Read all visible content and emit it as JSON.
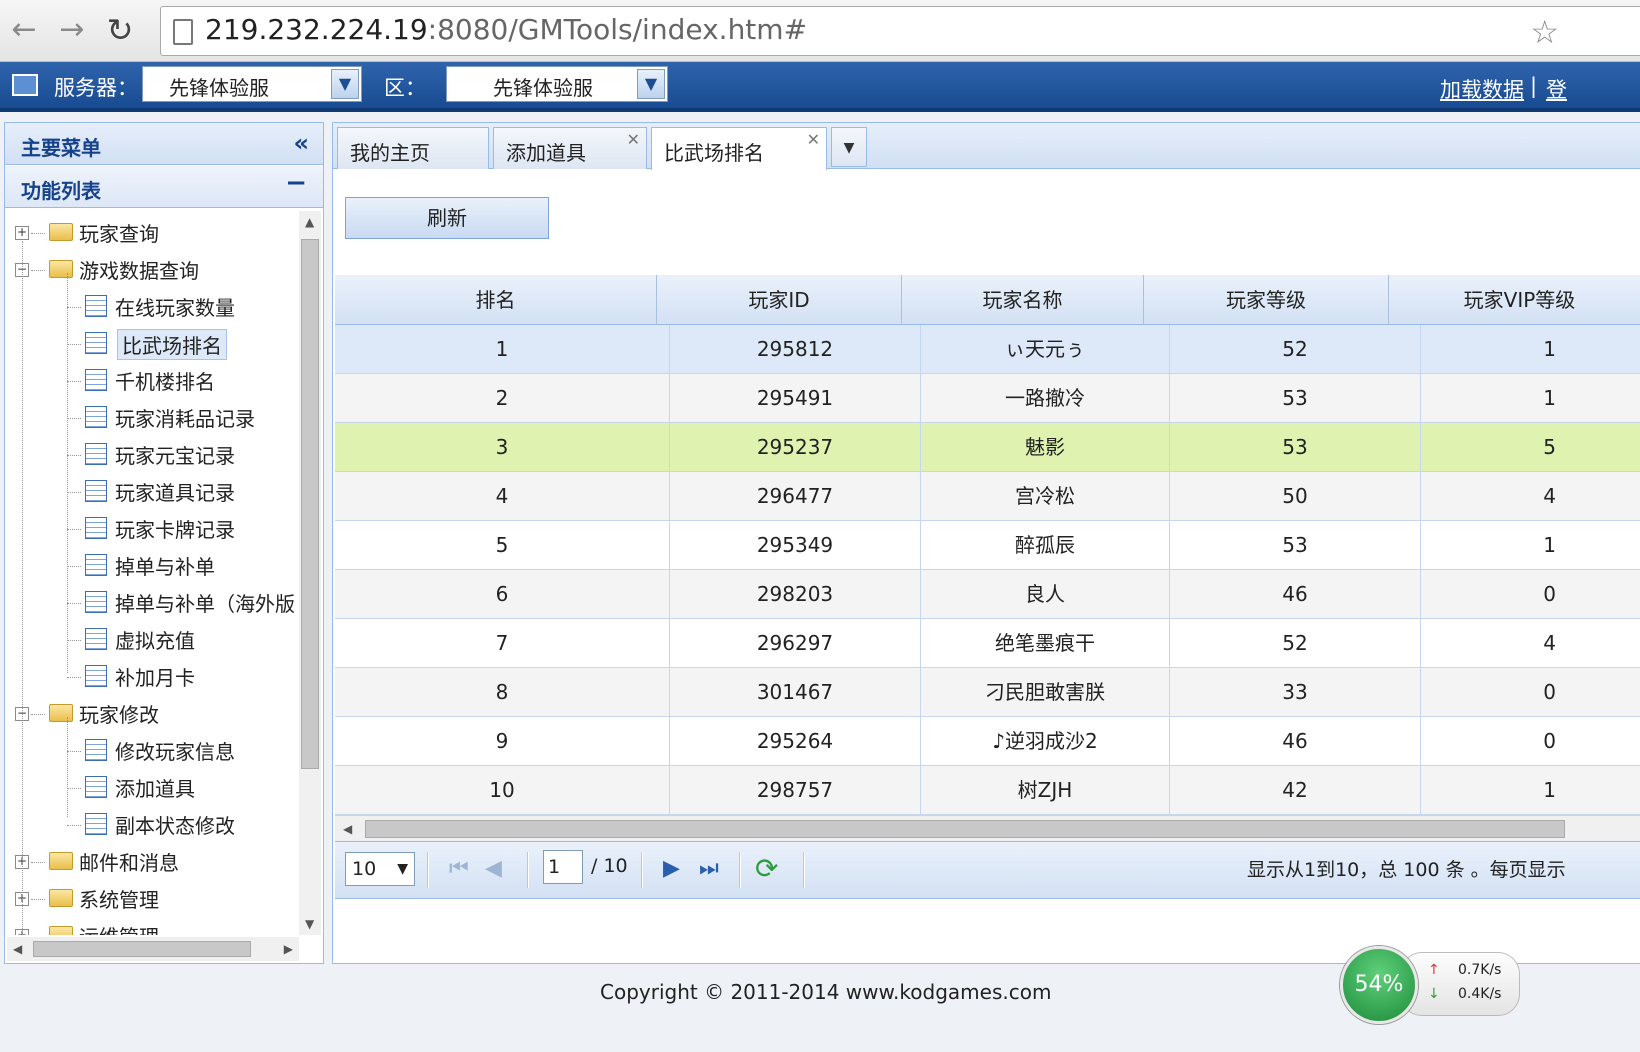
{
  "browser": {
    "url_host": "219.232.224.19",
    "url_rest": ":8080/GMTools/index.htm#"
  },
  "header": {
    "server_label": "服务器：",
    "server_value": "先锋体验服",
    "zone_label": "区：",
    "zone_value": "先锋体验服",
    "load_data": "加载数据",
    "separator": "|",
    "login": "登"
  },
  "sidebar": {
    "title": "主要菜单",
    "section": "功能列表",
    "tree": [
      {
        "label": "玩家查询",
        "type": "folder",
        "level": 0,
        "expanded": false
      },
      {
        "label": "游戏数据查询",
        "type": "folder",
        "level": 0,
        "expanded": true
      },
      {
        "label": "在线玩家数量",
        "type": "leaf",
        "level": 1
      },
      {
        "label": "比武场排名",
        "type": "leaf",
        "level": 1,
        "selected": true
      },
      {
        "label": "千机楼排名",
        "type": "leaf",
        "level": 1
      },
      {
        "label": "玩家消耗品记录",
        "type": "leaf",
        "level": 1
      },
      {
        "label": "玩家元宝记录",
        "type": "leaf",
        "level": 1
      },
      {
        "label": "玩家道具记录",
        "type": "leaf",
        "level": 1
      },
      {
        "label": "玩家卡牌记录",
        "type": "leaf",
        "level": 1
      },
      {
        "label": "掉单与补单",
        "type": "leaf",
        "level": 1
      },
      {
        "label": "掉单与补单（海外版",
        "type": "leaf",
        "level": 1
      },
      {
        "label": "虚拟充值",
        "type": "leaf",
        "level": 1
      },
      {
        "label": "补加月卡",
        "type": "leaf",
        "level": 1
      },
      {
        "label": "玩家修改",
        "type": "folder",
        "level": 0,
        "expanded": true
      },
      {
        "label": "修改玩家信息",
        "type": "leaf",
        "level": 1
      },
      {
        "label": "添加道具",
        "type": "leaf",
        "level": 1
      },
      {
        "label": "副本状态修改",
        "type": "leaf",
        "level": 1
      },
      {
        "label": "邮件和消息",
        "type": "folder",
        "level": 0,
        "expanded": false
      },
      {
        "label": "系统管理",
        "type": "folder",
        "level": 0,
        "expanded": false
      },
      {
        "label": "运维管理",
        "type": "folder",
        "level": 0,
        "expanded": false
      }
    ]
  },
  "tabs": [
    {
      "label": "我的主页",
      "closable": false
    },
    {
      "label": "添加道具",
      "closable": true
    },
    {
      "label": "比武场排名",
      "closable": true,
      "active": true
    }
  ],
  "toolbar": {
    "refresh": "刷新"
  },
  "table": {
    "columns": [
      "排名",
      "玩家ID",
      "玩家名称",
      "玩家等级",
      "玩家VIP等级"
    ],
    "rows": [
      [
        "1",
        "295812",
        "ぃ天元ぅ",
        "52",
        "1"
      ],
      [
        "2",
        "295491",
        "一路撤冷",
        "53",
        "1"
      ],
      [
        "3",
        "295237",
        "魅影",
        "53",
        "5"
      ],
      [
        "4",
        "296477",
        "宫冷松",
        "50",
        "4"
      ],
      [
        "5",
        "295349",
        "醉孤辰",
        "53",
        "1"
      ],
      [
        "6",
        "298203",
        "良人",
        "46",
        "0"
      ],
      [
        "7",
        "296297",
        "绝笔墨痕干",
        "52",
        "4"
      ],
      [
        "8",
        "301467",
        "刁民胆敢害朕",
        "33",
        "0"
      ],
      [
        "9",
        "295264",
        "♪逆羽成沙2",
        "46",
        "0"
      ],
      [
        "10",
        "298757",
        "树ZJH",
        "42",
        "1"
      ]
    ],
    "hover_color": "#dff2b0",
    "selected_color": "#dde9f8"
  },
  "pager": {
    "page_size": "10",
    "current_page": "1",
    "total_pages": "/ 10",
    "info": "显示从1到10，总 100 条 。每页显示"
  },
  "footer": {
    "copyright": "Copyright © 2011-2014 www.kodgames.com"
  },
  "net_widget": {
    "percent": "54%",
    "up": "0.7K/s",
    "down": "0.4K/s"
  }
}
